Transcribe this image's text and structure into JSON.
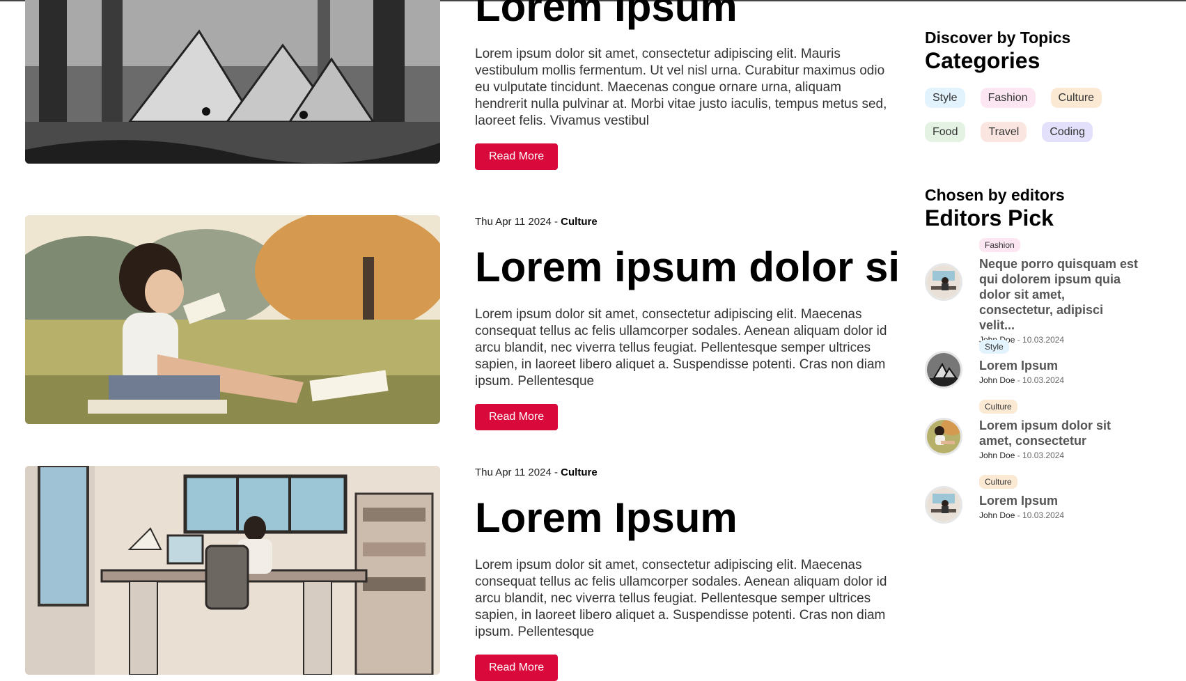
{
  "posts": [
    {
      "title": "Lorem Ipsum",
      "desc": "Lorem ipsum dolor sit amet, consectetur adipiscing elit. Mauris vestibulum mollis fermentum. Ut vel nisl urna. Curabitur maximus odio eu vulputate tincidunt. Maecenas congue ornare urna, aliquam hendrerit nulla pulvinar at. Morbi vitae justo iaculis, tempus metus sed, laoreet felis. Vivamus vestibul",
      "button": "Read More",
      "image": "forest-tents-illustration"
    },
    {
      "date": "Thu Apr 11 2024",
      "sep": " - ",
      "category": "Culture",
      "title": "Lorem ipsum dolor si",
      "desc": "Lorem ipsum dolor sit amet, consectetur adipiscing elit. Maecenas consequat tellus ac felis ullamcorper sodales. Aenean aliquam dolor id arcu blandit, nec viverra tellus feugiat. Pellentesque semper ultrices sapien, in laoreet libero aliquet a. Suspendisse potenti. Cras non diam ipsum. Pellentesque",
      "button": "Read More",
      "image": "girl-reading-in-park-illustration"
    },
    {
      "date": "Thu Apr 11 2024",
      "sep": " - ",
      "category": "Culture",
      "title": "Lorem Ipsum",
      "desc": "Lorem ipsum dolor sit amet, consectetur adipiscing elit. Maecenas consequat tellus ac felis ullamcorper sodales. Aenean aliquam dolor id arcu blandit, nec viverra tellus feugiat. Pellentesque semper ultrices sapien, in laoreet libero aliquet a. Suspendisse potenti. Cras non diam ipsum. Pellentesque",
      "button": "Read More",
      "image": "man-at-desk-illustration"
    }
  ],
  "sidebar": {
    "categories_sub": "Discover by Topics",
    "categories_title": "Categories",
    "categories": [
      {
        "label": "Style",
        "color": "#e3f3fd"
      },
      {
        "label": "Fashion",
        "color": "#fbe6f1"
      },
      {
        "label": "Culture",
        "color": "#fbe9d4"
      },
      {
        "label": "Food",
        "color": "#e4f2e3"
      },
      {
        "label": "Travel",
        "color": "#fbe5e0"
      },
      {
        "label": "Coding",
        "color": "#e2e0fb"
      }
    ],
    "editors_sub": "Chosen by editors",
    "editors_title": "Editors Pick",
    "picks": [
      {
        "tag": "Fashion",
        "tag_color": "#fbe6f1",
        "title": "Neque porro quisquam est qui dolorem ipsum quia dolor sit amet, consectetur, adipisci velit...",
        "author": "John Doe",
        "date": " - 10.03.2024",
        "avatar": "desk-avatar-icon"
      },
      {
        "tag": "Style",
        "tag_color": "#e3f3fd",
        "title": "Lorem Ipsum",
        "author": "John Doe",
        "date": " - 10.03.2024",
        "avatar": "tents-avatar-icon"
      },
      {
        "tag": "Culture",
        "tag_color": "#fbe9d4",
        "title": "Lorem ipsum dolor sit amet, consectetur",
        "author": "John Doe",
        "date": " - 10.03.2024",
        "avatar": "reading-avatar-icon"
      },
      {
        "tag": "Culture",
        "tag_color": "#fbe9d4",
        "title": "Lorem Ipsum",
        "author": "John Doe",
        "date": " - 10.03.2024",
        "avatar": "desk-avatar-icon"
      }
    ]
  },
  "colors": {
    "accent": "#d90a3b"
  }
}
